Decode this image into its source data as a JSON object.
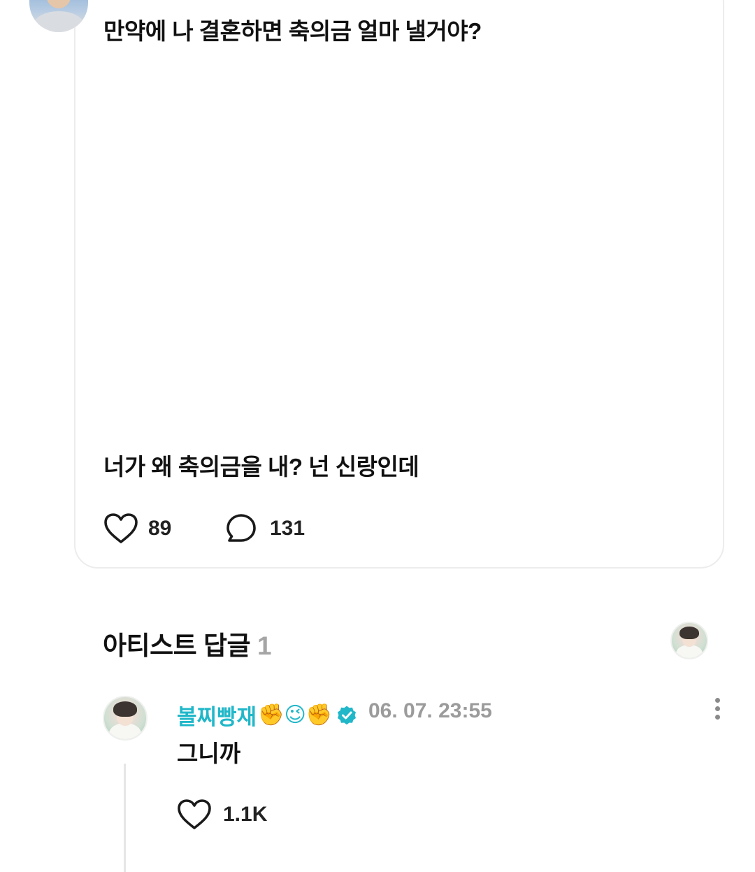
{
  "post": {
    "question": "만약에 나 결혼하면 축의금 얼마 낼거야?",
    "answer": "너가 왜 축의금을 내? 넌 신랑인데",
    "likes": "89",
    "comments": "131"
  },
  "replies_section": {
    "title": "아티스트 답글",
    "count": "1"
  },
  "reply": {
    "author": "볼찌빵재",
    "emojis": "✊😉✊",
    "time": "06. 07. 23:55",
    "text": "그니까",
    "likes": "1.1K"
  },
  "colors": {
    "accent": "#20b7c9",
    "muted": "#9b9b9b",
    "card_border": "#ececec"
  },
  "icons": [
    "heart-outline-icon",
    "speech-bubble-icon",
    "verified-badge-icon",
    "more-vertical-icon"
  ]
}
